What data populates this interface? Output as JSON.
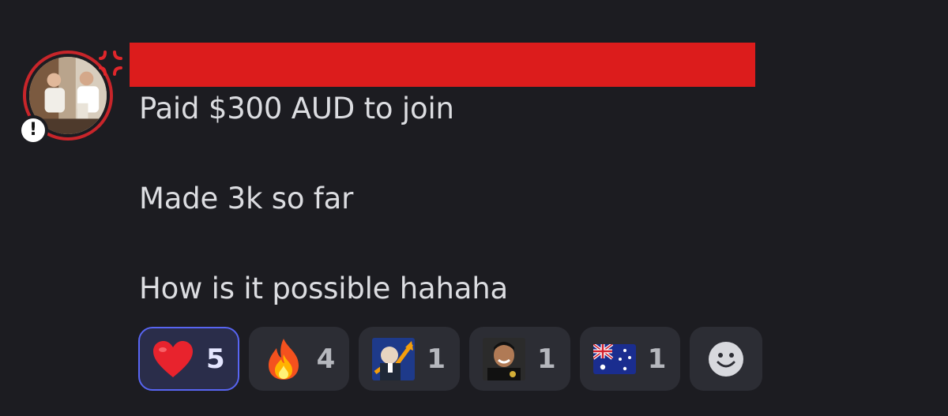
{
  "message": {
    "lines": [
      "Paid $300 AUD to join",
      "Made 3k so far",
      "How is it possible hahaha"
    ],
    "author_redacted": true,
    "redaction_color": "#dc1c1c"
  },
  "avatar": {
    "ring_color": "#c8252a",
    "badge_icon": "exclamation-icon",
    "badge_glyph": "!",
    "status_icon": "anger-symbol-icon"
  },
  "reactions": [
    {
      "emoji": "red-heart",
      "count": "5",
      "selected": true
    },
    {
      "emoji": "fire",
      "count": "4",
      "selected": false
    },
    {
      "emoji": "stonks-meme",
      "count": "1",
      "selected": false
    },
    {
      "emoji": "smiling-man-custom",
      "count": "1",
      "selected": false
    },
    {
      "emoji": "flag-australia",
      "count": "1",
      "selected": false
    }
  ],
  "add_reaction": {
    "icon": "smiley-face-icon"
  },
  "colors": {
    "background": "#1c1c21",
    "reaction_bg": "#2c2d34",
    "reaction_selected_bg": "#2a2d4a",
    "accent": "#5865f2",
    "text": "#dcdde1"
  }
}
